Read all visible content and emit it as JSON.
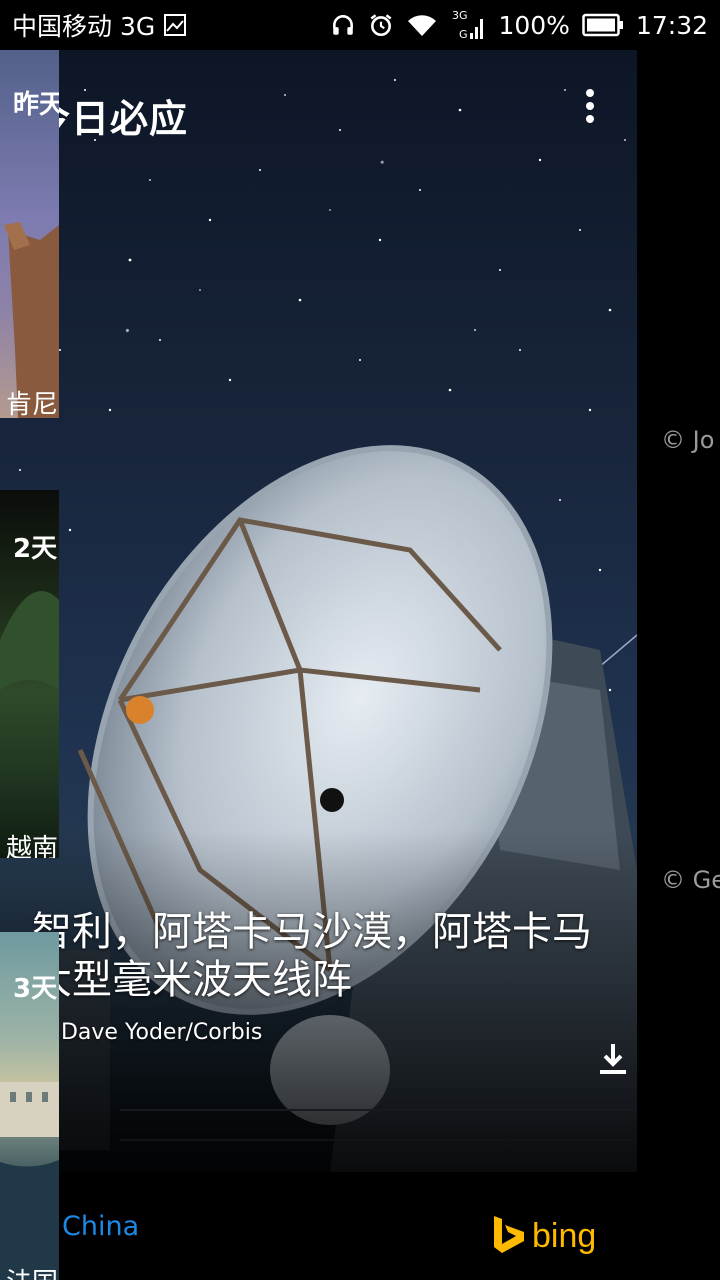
{
  "status_bar": {
    "carrier": "中国移动 3G",
    "network_small": "3G",
    "battery": "100%",
    "time": "17:32"
  },
  "hero": {
    "app_title": "今日必应",
    "caption": "智利，阿塔卡马沙漠，阿塔卡马大型毫米波天线阵",
    "copyright": "© Dave Yoder/Corbis"
  },
  "bottom_bar": {
    "region": "China",
    "brand": "bing",
    "brand_color": "#ffb900",
    "region_color": "#1e88e5"
  },
  "side_cards": [
    {
      "label": "昨天",
      "caption": "肯尼",
      "credit": "© Jo"
    },
    {
      "label": "2天",
      "caption": "越南",
      "credit": "© Ge"
    },
    {
      "label": "3天",
      "caption": "法国",
      "credit": ""
    }
  ],
  "icons": {
    "sim_image": "image-icon",
    "headphones": "headphones-icon",
    "alarm": "alarm-icon",
    "wifi": "wifi-icon",
    "signal": "signal-icon",
    "battery": "battery-icon",
    "more": "more-vert-icon",
    "download": "download-icon",
    "globe": "globe-icon",
    "bing_logo": "bing-logo-icon"
  }
}
